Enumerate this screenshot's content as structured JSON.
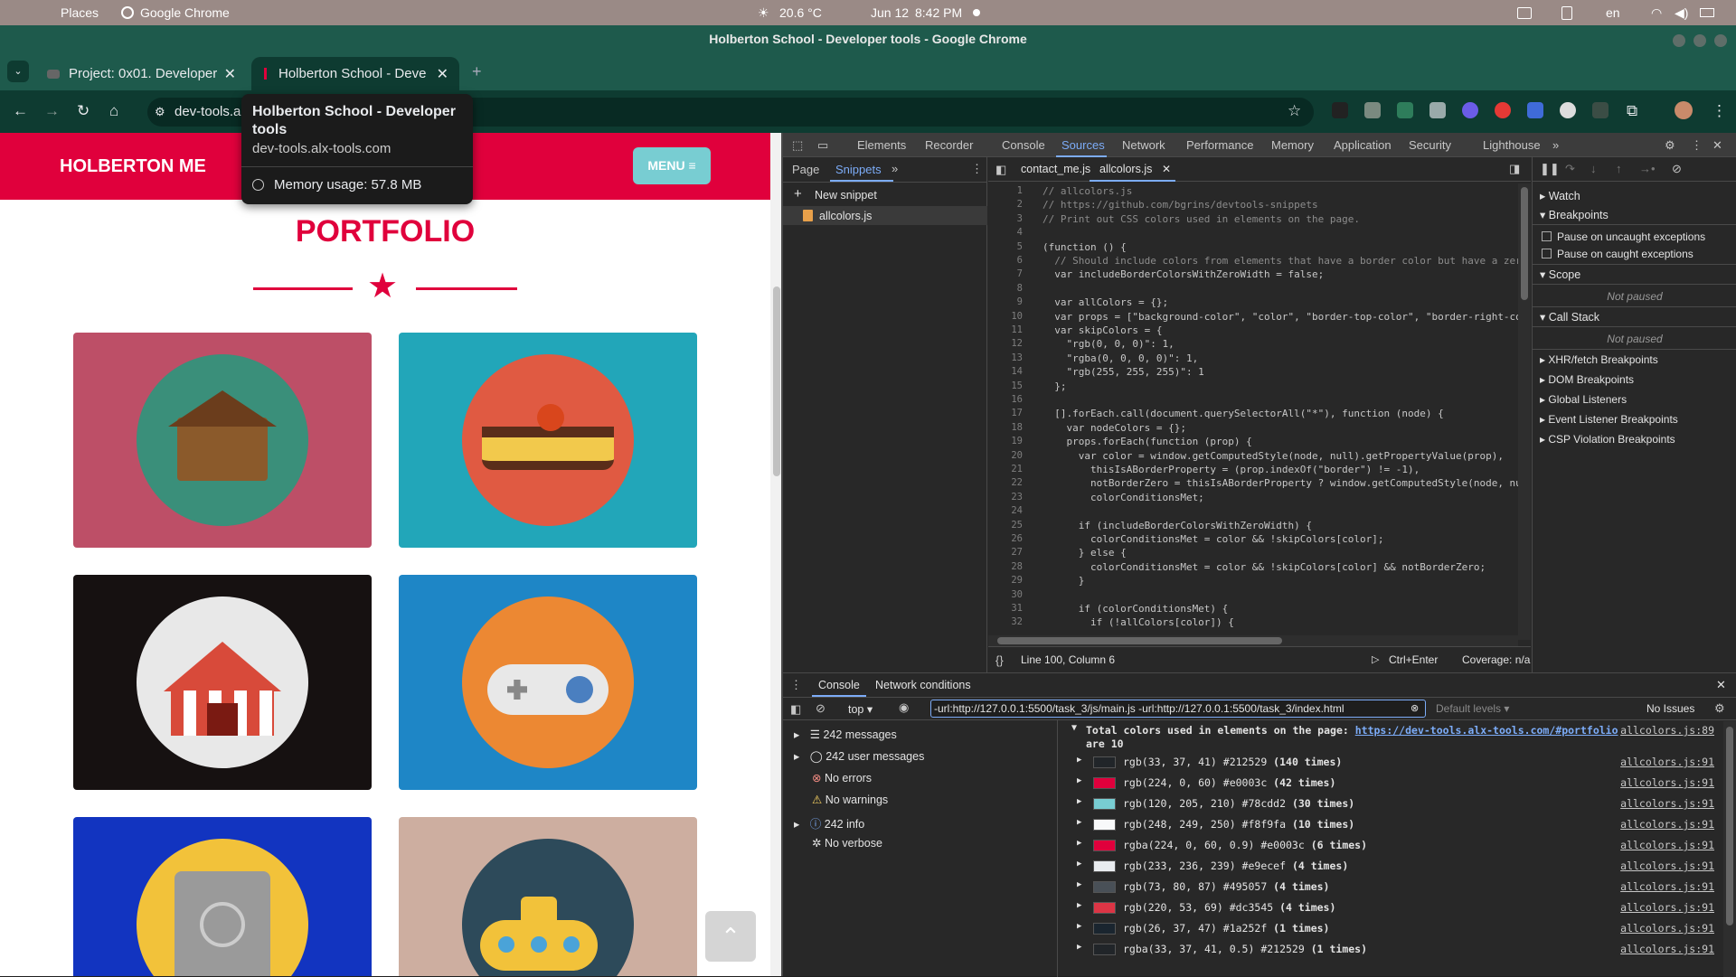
{
  "os": {
    "places": "Places",
    "app": "Google Chrome",
    "temp": "20.6 °C",
    "date": "Jun 12",
    "time": "8:42 PM",
    "lang": "en"
  },
  "window": {
    "title": "Holberton School - Developer tools - Google Chrome"
  },
  "tabs": [
    {
      "label": "Project: 0x01. Developer"
    },
    {
      "label": "Holberton School - Deve"
    }
  ],
  "toolbar": {
    "url": "dev-tools.al"
  },
  "tooltip": {
    "title": "Holberton School - Developer tools",
    "domain": "dev-tools.alx-tools.com",
    "memory": "Memory usage: 57.8 MB"
  },
  "site": {
    "logo": "HOLBERTON ME",
    "menu": "MENU ≡",
    "portfolio": "PORTFOLIO"
  },
  "devtools": {
    "tabs": [
      "Elements",
      "Recorder",
      "Console",
      "Sources",
      "Network",
      "Performance",
      "Memory",
      "Application",
      "Security",
      "Lighthouse"
    ],
    "nav_tabs": [
      "Page",
      "Snippets"
    ],
    "new_snippet": "New snippet",
    "snippet_file": "allcolors.js",
    "editor_tabs": [
      "contact_me.js",
      "allcolors.js"
    ],
    "code": [
      "// allcolors.js",
      "// https://github.com/bgrins/devtools-snippets",
      "// Print out CSS colors used in elements on the page.",
      "",
      "(function () {",
      "  // Should include colors from elements that have a border color but have a zer",
      "  var includeBorderColorsWithZeroWidth = false;",
      "",
      "  var allColors = {};",
      "  var props = [\"background-color\", \"color\", \"border-top-color\", \"border-right-co",
      "  var skipColors = {",
      "    \"rgb(0, 0, 0)\": 1,",
      "    \"rgba(0, 0, 0, 0)\": 1,",
      "    \"rgb(255, 255, 255)\": 1",
      "  };",
      "",
      "  [].forEach.call(document.querySelectorAll(\"*\"), function (node) {",
      "    var nodeColors = {};",
      "    props.forEach(function (prop) {",
      "      var color = window.getComputedStyle(node, null).getPropertyValue(prop),",
      "        thisIsABorderProperty = (prop.indexOf(\"border\") != -1),",
      "        notBorderZero = thisIsABorderProperty ? window.getComputedStyle(node, nu",
      "        colorConditionsMet;",
      "",
      "      if (includeBorderColorsWithZeroWidth) {",
      "        colorConditionsMet = color && !skipColors[color];",
      "      } else {",
      "        colorConditionsMet = color && !skipColors[color] && notBorderZero;",
      "      }",
      "",
      "      if (colorConditionsMet) {",
      "        if (!allColors[color]) {"
    ],
    "status": {
      "position": "Line 100, Column 6",
      "run": "Ctrl+Enter",
      "coverage": "Coverage: n/a"
    },
    "sidebar": {
      "watch": "Watch",
      "breakpoints": "Breakpoints",
      "pause_uncaught": "Pause on uncaught exceptions",
      "pause_caught": "Pause on caught exceptions",
      "scope": "Scope",
      "not_paused": "Not paused",
      "call_stack": "Call Stack",
      "sections": [
        "XHR/fetch Breakpoints",
        "DOM Breakpoints",
        "Global Listeners",
        "Event Listener Breakpoints",
        "CSP Violation Breakpoints"
      ]
    },
    "drawer_tabs": [
      "Console",
      "Network conditions"
    ],
    "console": {
      "context": "top",
      "filter": "-url:http://127.0.0.1:5500/task_3/js/main.js -url:http://127.0.0.1:5500/task_3/index.html",
      "levels": "Default levels",
      "issues": "No Issues",
      "categories": [
        "242 messages",
        "242 user messages",
        "No errors",
        "No warnings",
        "242 info",
        "No verbose"
      ],
      "header_text": "Total colors used in elements on the page: ",
      "header_link": "https://dev-tools.alx-tools.com/#portfolio",
      "header_tail": "are 10",
      "header_src": "allcolors.js:89",
      "rows": [
        {
          "text": "rgb(33, 37, 41) #212529 ",
          "count": "(140 times)",
          "color": "#212529",
          "src": "allcolors.js:91"
        },
        {
          "text": "rgb(224, 0, 60) #e0003c ",
          "count": "(42 times)",
          "color": "#e0003c",
          "src": "allcolors.js:91"
        },
        {
          "text": "rgb(120, 205, 210) #78cdd2 ",
          "count": "(30 times)",
          "color": "#78cdd2",
          "src": "allcolors.js:91"
        },
        {
          "text": "rgb(248, 249, 250) #f8f9fa ",
          "count": "(10 times)",
          "color": "#f8f9fa",
          "src": "allcolors.js:91"
        },
        {
          "text": "rgba(224, 0, 60, 0.9) #e0003c ",
          "count": "(6 times)",
          "color": "#e0003c",
          "src": "allcolors.js:91"
        },
        {
          "text": "rgb(233, 236, 239) #e9ecef ",
          "count": "(4 times)",
          "color": "#e9ecef",
          "src": "allcolors.js:91"
        },
        {
          "text": "rgb(73, 80, 87) #495057 ",
          "count": "(4 times)",
          "color": "#495057",
          "src": "allcolors.js:91"
        },
        {
          "text": "rgb(220, 53, 69) #dc3545 ",
          "count": "(4 times)",
          "color": "#dc3545",
          "src": "allcolors.js:91"
        },
        {
          "text": "rgb(26, 37, 47) #1a252f ",
          "count": "(1 times)",
          "color": "#1a252f",
          "src": "allcolors.js:91"
        },
        {
          "text": "rgba(33, 37, 41, 0.5) #212529 ",
          "count": "(1 times)",
          "color": "#212529",
          "src": "allcolors.js:91"
        }
      ]
    }
  },
  "colors": {
    "brand": "#e0003c",
    "teal": "#78cdd2"
  }
}
